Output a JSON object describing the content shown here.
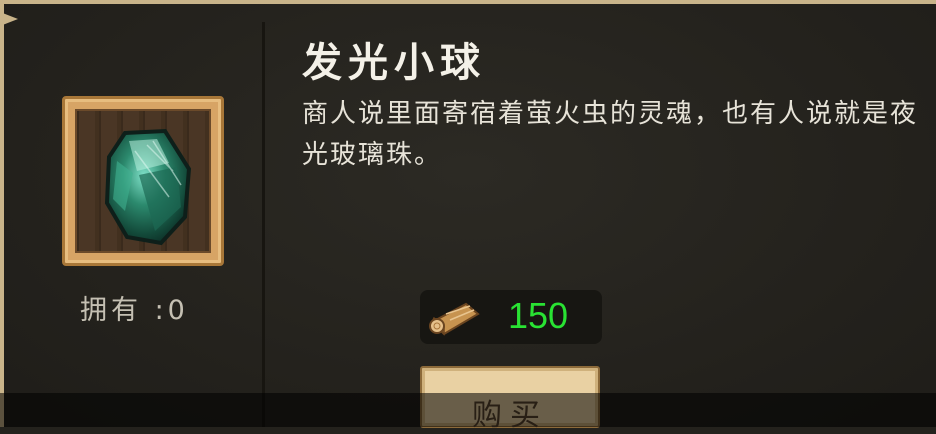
{
  "item": {
    "name": "发光小球",
    "description": "商人说里面寄宿着萤火虫的灵魂，也有人说就是夜光玻璃珠。",
    "icon": "glowing-green-gem-icon",
    "owned_label": "拥有 :0"
  },
  "price": {
    "currency_icon": "wood-log-icon",
    "amount": "150",
    "color": "#29e233"
  },
  "buy_button": {
    "label": "购买"
  },
  "colors": {
    "panel_background": "#24221d",
    "border_accent": "#c9b48a",
    "frame_wood": "#d7a465"
  }
}
